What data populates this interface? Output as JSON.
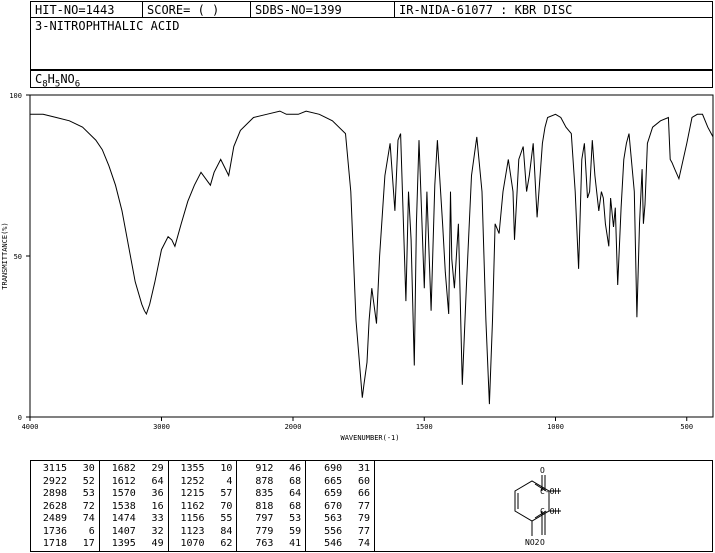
{
  "header": {
    "hit": "HIT-NO=1443",
    "score": "SCORE=  (   )",
    "sdbs": "SDBS-NO=1399",
    "method": "IR-NIDA-61077 : KBR DISC"
  },
  "compound": {
    "name": "3-NITROPHTHALIC ACID",
    "formula_parts": [
      "C",
      "8",
      "H",
      "5",
      "NO",
      "6"
    ]
  },
  "chart_data": {
    "type": "line",
    "xlabel": "WAVENUMBER(-1)",
    "ylabel": "TRANSMITTANCE(%)",
    "xlim": [
      4000,
      400
    ],
    "ylim": [
      0,
      100
    ],
    "x_ticks": [
      4000,
      3000,
      2000,
      1500,
      1000,
      500
    ],
    "y_ticks": [
      0,
      50,
      100
    ],
    "grid": false,
    "series": [
      {
        "x": [
          4000,
          3900,
          3800,
          3700,
          3600,
          3500,
          3450,
          3400,
          3350,
          3300,
          3250,
          3200,
          3150,
          3130,
          3115,
          3090,
          3050,
          3000,
          2950,
          2922,
          2898,
          2850,
          2800,
          2750,
          2700,
          2628,
          2600,
          2550,
          2489,
          2450,
          2400,
          2300,
          2200,
          2100,
          2050,
          2000,
          1980,
          1950,
          1900,
          1850,
          1800,
          1780,
          1760,
          1736,
          1730,
          1718,
          1710,
          1700,
          1682,
          1670,
          1650,
          1630,
          1612,
          1600,
          1590,
          1570,
          1560,
          1550,
          1538,
          1530,
          1520,
          1500,
          1490,
          1474,
          1460,
          1450,
          1430,
          1420,
          1407,
          1400,
          1395,
          1385,
          1370,
          1355,
          1340,
          1320,
          1300,
          1280,
          1265,
          1252,
          1240,
          1230,
          1215,
          1200,
          1180,
          1162,
          1156,
          1140,
          1123,
          1110,
          1100,
          1085,
          1070,
          1050,
          1040,
          1030,
          1000,
          980,
          960,
          940,
          925,
          912,
          900,
          890,
          878,
          870,
          860,
          850,
          835,
          825,
          818,
          810,
          797,
          790,
          779,
          772,
          763,
          750,
          740,
          730,
          720,
          700,
          690,
          680,
          670,
          665,
          659,
          650,
          630,
          600,
          570,
          563,
          556,
          546,
          530,
          500,
          480,
          460,
          440,
          420,
          400
        ],
        "values": [
          94,
          94,
          93,
          92,
          90,
          86,
          83,
          78,
          72,
          64,
          53,
          42,
          35,
          33,
          32,
          35,
          42,
          52,
          56,
          55,
          53,
          60,
          67,
          72,
          76,
          72,
          76,
          80,
          75,
          84,
          89,
          93,
          94,
          95,
          94,
          94,
          94,
          95,
          94,
          92,
          88,
          70,
          30,
          6,
          10,
          17,
          30,
          40,
          29,
          50,
          75,
          85,
          64,
          86,
          88,
          36,
          70,
          55,
          16,
          60,
          86,
          40,
          70,
          33,
          72,
          86,
          60,
          45,
          32,
          70,
          49,
          40,
          60,
          10,
          40,
          75,
          87,
          70,
          30,
          4,
          30,
          60,
          57,
          70,
          80,
          70,
          55,
          80,
          84,
          70,
          75,
          85,
          62,
          85,
          90,
          93,
          94,
          93,
          90,
          88,
          70,
          46,
          80,
          85,
          68,
          70,
          86,
          75,
          64,
          70,
          68,
          60,
          53,
          68,
          59,
          65,
          41,
          65,
          80,
          85,
          88,
          70,
          31,
          60,
          77,
          60,
          66,
          85,
          90,
          92,
          93,
          80,
          79,
          77,
          74,
          85,
          93,
          94,
          94,
          90,
          87
        ]
      }
    ],
    "peak_table": [
      [
        [
          "3115",
          "30"
        ],
        [
          "2922",
          "52"
        ],
        [
          "2898",
          "53"
        ],
        [
          "2628",
          "72"
        ],
        [
          "2489",
          "74"
        ],
        [
          "1736",
          "6"
        ],
        [
          "1718",
          "17"
        ]
      ],
      [
        [
          "1682",
          "29"
        ],
        [
          "1612",
          "64"
        ],
        [
          "1570",
          "36"
        ],
        [
          "1538",
          "16"
        ],
        [
          "1474",
          "33"
        ],
        [
          "1407",
          "32"
        ],
        [
          "1395",
          "49"
        ]
      ],
      [
        [
          "1355",
          "10"
        ],
        [
          "1252",
          "4"
        ],
        [
          "1215",
          "57"
        ],
        [
          "1162",
          "70"
        ],
        [
          "1156",
          "55"
        ],
        [
          "1123",
          "84"
        ],
        [
          "1070",
          "62"
        ]
      ],
      [
        [
          "912",
          "46"
        ],
        [
          "878",
          "68"
        ],
        [
          "835",
          "64"
        ],
        [
          "818",
          "68"
        ],
        [
          "797",
          "53"
        ],
        [
          "779",
          "59"
        ],
        [
          "763",
          "41"
        ]
      ],
      [
        [
          "690",
          "31"
        ],
        [
          "665",
          "60"
        ],
        [
          "659",
          "66"
        ],
        [
          "670",
          "77"
        ],
        [
          "563",
          "79"
        ],
        [
          "556",
          "77"
        ],
        [
          "546",
          "74"
        ]
      ]
    ]
  },
  "structure": {
    "oh_top": "C-OH",
    "o_top": "O",
    "oh_bottom": "C-OH",
    "o_bottom": "O",
    "nitro": "NO2"
  }
}
